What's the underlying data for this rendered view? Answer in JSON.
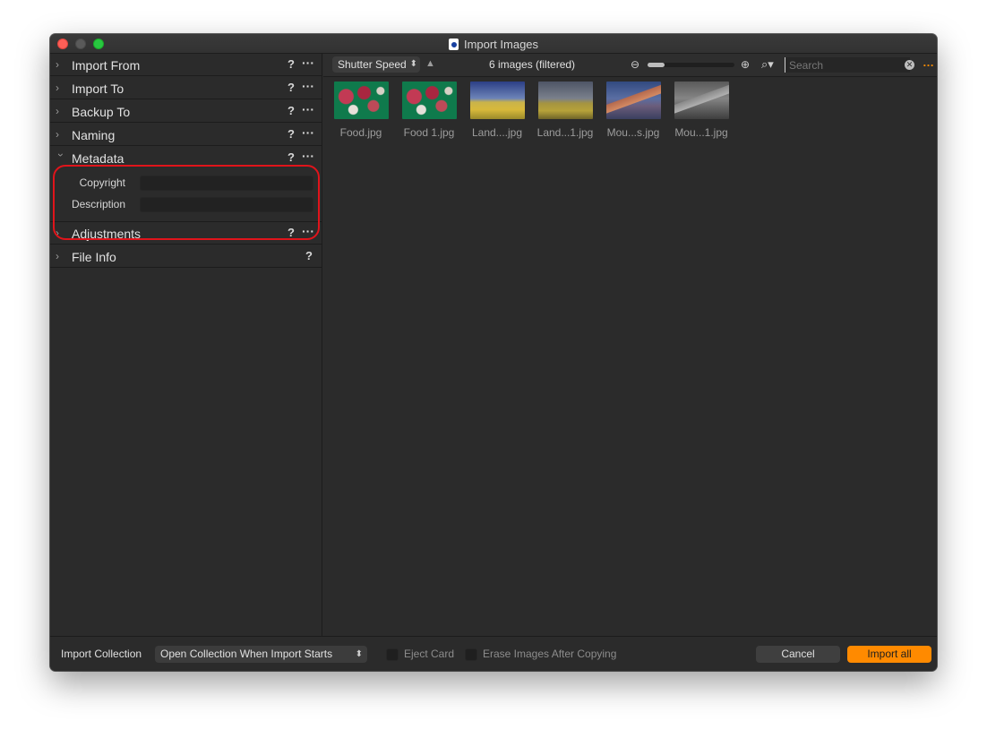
{
  "window": {
    "title": "Import Images",
    "app_icon": "capture-one-icon"
  },
  "sidebar": {
    "sections": [
      {
        "label": "Import From",
        "expanded": false,
        "has_more": true
      },
      {
        "label": "Import To",
        "expanded": false,
        "has_more": true
      },
      {
        "label": "Backup To",
        "expanded": false,
        "has_more": true
      },
      {
        "label": "Naming",
        "expanded": false,
        "has_more": true
      },
      {
        "label": "Metadata",
        "expanded": true,
        "has_more": true
      },
      {
        "label": "Adjustments",
        "expanded": false,
        "has_more": true
      },
      {
        "label": "File Info",
        "expanded": false,
        "has_more": false
      }
    ],
    "help_glyph": "?",
    "more_glyph": "···",
    "metadata_fields": {
      "copyright_label": "Copyright",
      "copyright_value": "",
      "description_label": "Description",
      "description_value": ""
    },
    "highlight_color": "#e0141b"
  },
  "toolbar": {
    "sort_by": "Shutter Speed",
    "sort_direction": "ascending",
    "count_text": "6 images (filtered)",
    "zoom_level": 0.2,
    "search_placeholder": "Search",
    "search_value": ""
  },
  "images": [
    {
      "name": "Food.jpg",
      "thumb": "food"
    },
    {
      "name": "Food 1.jpg",
      "thumb": "food"
    },
    {
      "name": "Land....jpg",
      "thumb": "land"
    },
    {
      "name": "Land...1.jpg",
      "thumb": "land2"
    },
    {
      "name": "Mou...s.jpg",
      "thumb": "mou"
    },
    {
      "name": "Mou...1.jpg",
      "thumb": "mou2"
    }
  ],
  "footer": {
    "collection_label": "Import Collection",
    "collection_value": "Open Collection When Import Starts",
    "eject_label": "Eject Card",
    "eject_checked": false,
    "erase_label": "Erase Images After Copying",
    "erase_checked": false,
    "cancel_label": "Cancel",
    "import_label": "Import all",
    "accent_color": "#ff8a00"
  }
}
